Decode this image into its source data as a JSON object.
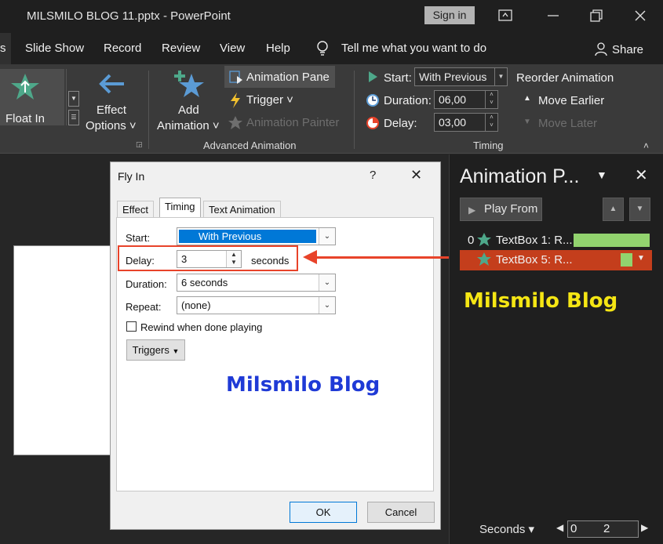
{
  "titlebar": {
    "title": "MILSMILO BLOG 11.pptx  -  PowerPoint",
    "signin": "Sign in"
  },
  "menu": {
    "active_tab": "s",
    "tabs": [
      "Slide Show",
      "Record",
      "Review",
      "View",
      "Help"
    ],
    "tell_me": "Tell me what you want to do",
    "share": "Share"
  },
  "ribbon": {
    "float_in": "Float In",
    "effect_options_1": "Effect",
    "effect_options_2": "Options ˅",
    "add_animation_1": "Add",
    "add_animation_2": "Animation ˅",
    "animation_pane": "Animation Pane",
    "trigger": "Trigger ˅",
    "animation_painter": "Animation Painter",
    "advanced_animation_label": "Advanced Animation",
    "start_label": "Start:",
    "start_value": "With Previous",
    "duration_label": "Duration:",
    "duration_value": "06,00",
    "delay_label": "Delay:",
    "delay_value": "03,00",
    "timing_label": "Timing",
    "reorder": "Reorder Animation",
    "move_earlier": "Move Earlier",
    "move_later": "Move Later"
  },
  "dialog": {
    "title": "Fly In",
    "help": "?",
    "close": "✕",
    "tabs": [
      "Effect",
      "Timing",
      "Text Animation"
    ],
    "start_label": "Start:",
    "start_value": "With Previous",
    "delay_label": "Delay:",
    "delay_value": "3",
    "delay_unit": "seconds",
    "duration_label": "Duration:",
    "duration_value": "6 seconds",
    "repeat_label": "Repeat:",
    "repeat_value": "(none)",
    "rewind_label": "Rewind when done playing",
    "triggers": "Triggers",
    "ok": "OK",
    "cancel": "Cancel"
  },
  "watermarks": {
    "dialog": "Milsmilo Blog",
    "pane": "Milsmilo Blog"
  },
  "colors": {
    "watermark_dialog": "#1f3ad6",
    "watermark_pane": "#f5e614",
    "highlight": "#e8432a",
    "selected_row": "#c43e1c",
    "bar": "#92d36e",
    "star": "#4ea88a"
  },
  "anim_pane": {
    "title": "Animation P...",
    "play_from": "Play From",
    "items": [
      {
        "index": "0",
        "label": "TextBox 1: R..."
      },
      {
        "index": "",
        "label": "TextBox 5: R..."
      }
    ],
    "footer_seconds": "Seconds ▾",
    "timeline_0": "0",
    "timeline_2": "2"
  }
}
